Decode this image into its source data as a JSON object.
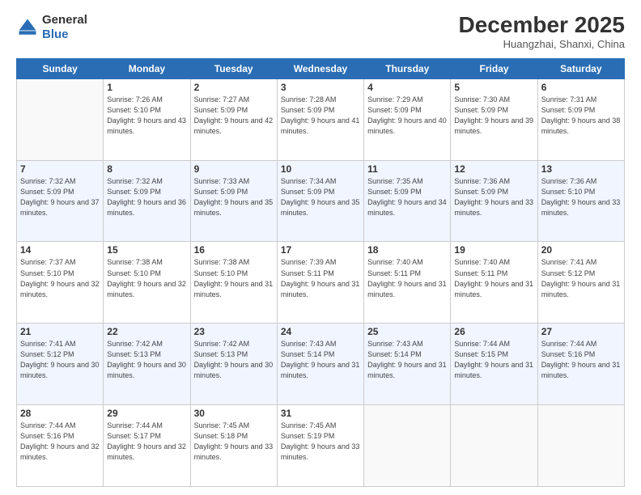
{
  "header": {
    "logo_line1": "General",
    "logo_line2": "Blue",
    "month": "December 2025",
    "location": "Huangzhai, Shanxi, China"
  },
  "days_of_week": [
    "Sunday",
    "Monday",
    "Tuesday",
    "Wednesday",
    "Thursday",
    "Friday",
    "Saturday"
  ],
  "weeks": [
    [
      {
        "day": "",
        "sunrise": "",
        "sunset": "",
        "daylight": ""
      },
      {
        "day": "1",
        "sunrise": "Sunrise: 7:26 AM",
        "sunset": "Sunset: 5:10 PM",
        "daylight": "Daylight: 9 hours and 43 minutes."
      },
      {
        "day": "2",
        "sunrise": "Sunrise: 7:27 AM",
        "sunset": "Sunset: 5:09 PM",
        "daylight": "Daylight: 9 hours and 42 minutes."
      },
      {
        "day": "3",
        "sunrise": "Sunrise: 7:28 AM",
        "sunset": "Sunset: 5:09 PM",
        "daylight": "Daylight: 9 hours and 41 minutes."
      },
      {
        "day": "4",
        "sunrise": "Sunrise: 7:29 AM",
        "sunset": "Sunset: 5:09 PM",
        "daylight": "Daylight: 9 hours and 40 minutes."
      },
      {
        "day": "5",
        "sunrise": "Sunrise: 7:30 AM",
        "sunset": "Sunset: 5:09 PM",
        "daylight": "Daylight: 9 hours and 39 minutes."
      },
      {
        "day": "6",
        "sunrise": "Sunrise: 7:31 AM",
        "sunset": "Sunset: 5:09 PM",
        "daylight": "Daylight: 9 hours and 38 minutes."
      }
    ],
    [
      {
        "day": "7",
        "sunrise": "Sunrise: 7:32 AM",
        "sunset": "Sunset: 5:09 PM",
        "daylight": "Daylight: 9 hours and 37 minutes."
      },
      {
        "day": "8",
        "sunrise": "Sunrise: 7:32 AM",
        "sunset": "Sunset: 5:09 PM",
        "daylight": "Daylight: 9 hours and 36 minutes."
      },
      {
        "day": "9",
        "sunrise": "Sunrise: 7:33 AM",
        "sunset": "Sunset: 5:09 PM",
        "daylight": "Daylight: 9 hours and 35 minutes."
      },
      {
        "day": "10",
        "sunrise": "Sunrise: 7:34 AM",
        "sunset": "Sunset: 5:09 PM",
        "daylight": "Daylight: 9 hours and 35 minutes."
      },
      {
        "day": "11",
        "sunrise": "Sunrise: 7:35 AM",
        "sunset": "Sunset: 5:09 PM",
        "daylight": "Daylight: 9 hours and 34 minutes."
      },
      {
        "day": "12",
        "sunrise": "Sunrise: 7:36 AM",
        "sunset": "Sunset: 5:09 PM",
        "daylight": "Daylight: 9 hours and 33 minutes."
      },
      {
        "day": "13",
        "sunrise": "Sunrise: 7:36 AM",
        "sunset": "Sunset: 5:10 PM",
        "daylight": "Daylight: 9 hours and 33 minutes."
      }
    ],
    [
      {
        "day": "14",
        "sunrise": "Sunrise: 7:37 AM",
        "sunset": "Sunset: 5:10 PM",
        "daylight": "Daylight: 9 hours and 32 minutes."
      },
      {
        "day": "15",
        "sunrise": "Sunrise: 7:38 AM",
        "sunset": "Sunset: 5:10 PM",
        "daylight": "Daylight: 9 hours and 32 minutes."
      },
      {
        "day": "16",
        "sunrise": "Sunrise: 7:38 AM",
        "sunset": "Sunset: 5:10 PM",
        "daylight": "Daylight: 9 hours and 31 minutes."
      },
      {
        "day": "17",
        "sunrise": "Sunrise: 7:39 AM",
        "sunset": "Sunset: 5:11 PM",
        "daylight": "Daylight: 9 hours and 31 minutes."
      },
      {
        "day": "18",
        "sunrise": "Sunrise: 7:40 AM",
        "sunset": "Sunset: 5:11 PM",
        "daylight": "Daylight: 9 hours and 31 minutes."
      },
      {
        "day": "19",
        "sunrise": "Sunrise: 7:40 AM",
        "sunset": "Sunset: 5:11 PM",
        "daylight": "Daylight: 9 hours and 31 minutes."
      },
      {
        "day": "20",
        "sunrise": "Sunrise: 7:41 AM",
        "sunset": "Sunset: 5:12 PM",
        "daylight": "Daylight: 9 hours and 31 minutes."
      }
    ],
    [
      {
        "day": "21",
        "sunrise": "Sunrise: 7:41 AM",
        "sunset": "Sunset: 5:12 PM",
        "daylight": "Daylight: 9 hours and 30 minutes."
      },
      {
        "day": "22",
        "sunrise": "Sunrise: 7:42 AM",
        "sunset": "Sunset: 5:13 PM",
        "daylight": "Daylight: 9 hours and 30 minutes."
      },
      {
        "day": "23",
        "sunrise": "Sunrise: 7:42 AM",
        "sunset": "Sunset: 5:13 PM",
        "daylight": "Daylight: 9 hours and 30 minutes."
      },
      {
        "day": "24",
        "sunrise": "Sunrise: 7:43 AM",
        "sunset": "Sunset: 5:14 PM",
        "daylight": "Daylight: 9 hours and 31 minutes."
      },
      {
        "day": "25",
        "sunrise": "Sunrise: 7:43 AM",
        "sunset": "Sunset: 5:14 PM",
        "daylight": "Daylight: 9 hours and 31 minutes."
      },
      {
        "day": "26",
        "sunrise": "Sunrise: 7:44 AM",
        "sunset": "Sunset: 5:15 PM",
        "daylight": "Daylight: 9 hours and 31 minutes."
      },
      {
        "day": "27",
        "sunrise": "Sunrise: 7:44 AM",
        "sunset": "Sunset: 5:16 PM",
        "daylight": "Daylight: 9 hours and 31 minutes."
      }
    ],
    [
      {
        "day": "28",
        "sunrise": "Sunrise: 7:44 AM",
        "sunset": "Sunset: 5:16 PM",
        "daylight": "Daylight: 9 hours and 32 minutes."
      },
      {
        "day": "29",
        "sunrise": "Sunrise: 7:44 AM",
        "sunset": "Sunset: 5:17 PM",
        "daylight": "Daylight: 9 hours and 32 minutes."
      },
      {
        "day": "30",
        "sunrise": "Sunrise: 7:45 AM",
        "sunset": "Sunset: 5:18 PM",
        "daylight": "Daylight: 9 hours and 33 minutes."
      },
      {
        "day": "31",
        "sunrise": "Sunrise: 7:45 AM",
        "sunset": "Sunset: 5:19 PM",
        "daylight": "Daylight: 9 hours and 33 minutes."
      },
      {
        "day": "",
        "sunrise": "",
        "sunset": "",
        "daylight": ""
      },
      {
        "day": "",
        "sunrise": "",
        "sunset": "",
        "daylight": ""
      },
      {
        "day": "",
        "sunrise": "",
        "sunset": "",
        "daylight": ""
      }
    ]
  ]
}
